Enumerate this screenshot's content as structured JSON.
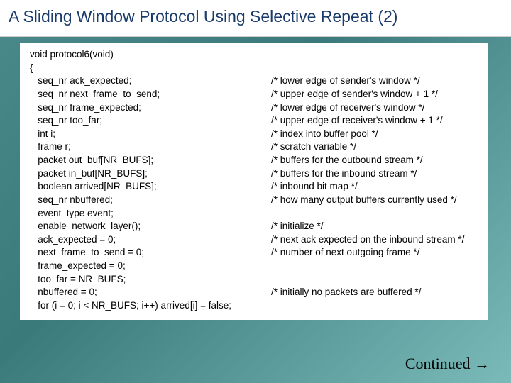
{
  "title": "A Sliding Window Protocol Using Selective Repeat (2)",
  "footer": "Continued →",
  "code": {
    "lines": [
      {
        "left": "void protocol6(void)",
        "right": ""
      },
      {
        "left": "{",
        "right": ""
      },
      {
        "left": "   seq_nr ack_expected;",
        "right": "/* lower edge of sender's window */"
      },
      {
        "left": "   seq_nr next_frame_to_send;",
        "right": "/* upper edge of sender's window + 1 */"
      },
      {
        "left": "   seq_nr frame_expected;",
        "right": "/* lower edge of receiver's window */"
      },
      {
        "left": "   seq_nr too_far;",
        "right": "/* upper edge of receiver's window + 1 */"
      },
      {
        "left": "   int i;",
        "right": "/* index into buffer pool */"
      },
      {
        "left": "   frame r;",
        "right": "/* scratch variable */"
      },
      {
        "left": "   packet out_buf[NR_BUFS];",
        "right": "/* buffers for the outbound stream */"
      },
      {
        "left": "   packet in_buf[NR_BUFS];",
        "right": "/* buffers for the inbound stream */"
      },
      {
        "left": "   boolean arrived[NR_BUFS];",
        "right": "/* inbound bit map */"
      },
      {
        "left": "   seq_nr nbuffered;",
        "right": "/* how many output buffers currently used */"
      },
      {
        "left": "   event_type event;",
        "right": ""
      },
      {
        "left": "",
        "right": ""
      },
      {
        "left": "   enable_network_layer();",
        "right": "/* initialize */"
      },
      {
        "left": "   ack_expected = 0;",
        "right": "/* next ack expected on the inbound stream */"
      },
      {
        "left": "   next_frame_to_send = 0;",
        "right": "/* number of next outgoing frame */"
      },
      {
        "left": "   frame_expected = 0;",
        "right": ""
      },
      {
        "left": "   too_far = NR_BUFS;",
        "right": ""
      },
      {
        "left": "   nbuffered = 0;",
        "right": "/* initially no packets are buffered */"
      },
      {
        "left": "   for (i = 0; i < NR_BUFS; i++) arrived[i] = false;",
        "right": ""
      }
    ]
  }
}
